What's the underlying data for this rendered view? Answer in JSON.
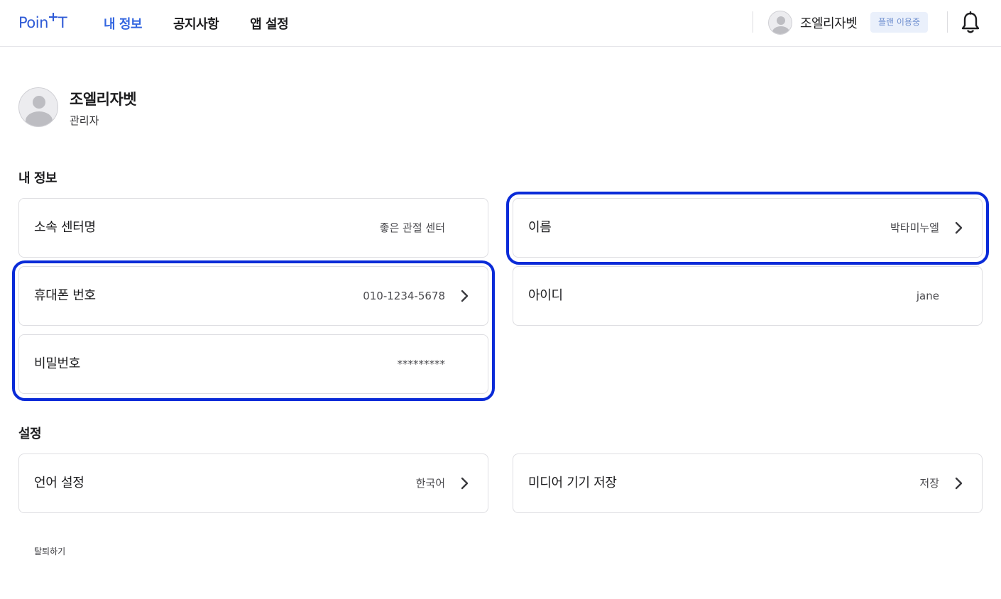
{
  "header": {
    "logo_left": "Poin",
    "logo_right": "T",
    "nav": [
      {
        "label": "내 정보",
        "active": true
      },
      {
        "label": "공지사항",
        "active": false
      },
      {
        "label": "앱 설정",
        "active": false
      }
    ],
    "user_name": "조엘리자벳",
    "plan_badge": "플랜 이용중"
  },
  "profile": {
    "name": "조엘리자벳",
    "role": "관리자"
  },
  "my_info": {
    "title": "내 정보",
    "center": {
      "label": "소속 센터명",
      "value": "좋은 관절 센터"
    },
    "name": {
      "label": "이름",
      "value": "박타미누엘"
    },
    "phone": {
      "label": "휴대폰 번호",
      "value": "010-1234-5678"
    },
    "user_id": {
      "label": "아이디",
      "value": "jane"
    },
    "password": {
      "label": "비밀번호",
      "value": "*********"
    }
  },
  "settings": {
    "title": "설정",
    "language": {
      "label": "언어 설정",
      "value": "한국어"
    },
    "media_storage": {
      "label": "미디어 기기 저장",
      "value": "저장"
    }
  },
  "withdraw_label": "탈퇴하기",
  "colors": {
    "accent": "#3366e0",
    "highlight": "#0a2bd8",
    "badge_bg": "#eaf0fb",
    "badge_text": "#6f8fcf"
  },
  "icons": [
    "person-icon",
    "bell-icon",
    "chevron-right-icon"
  ]
}
